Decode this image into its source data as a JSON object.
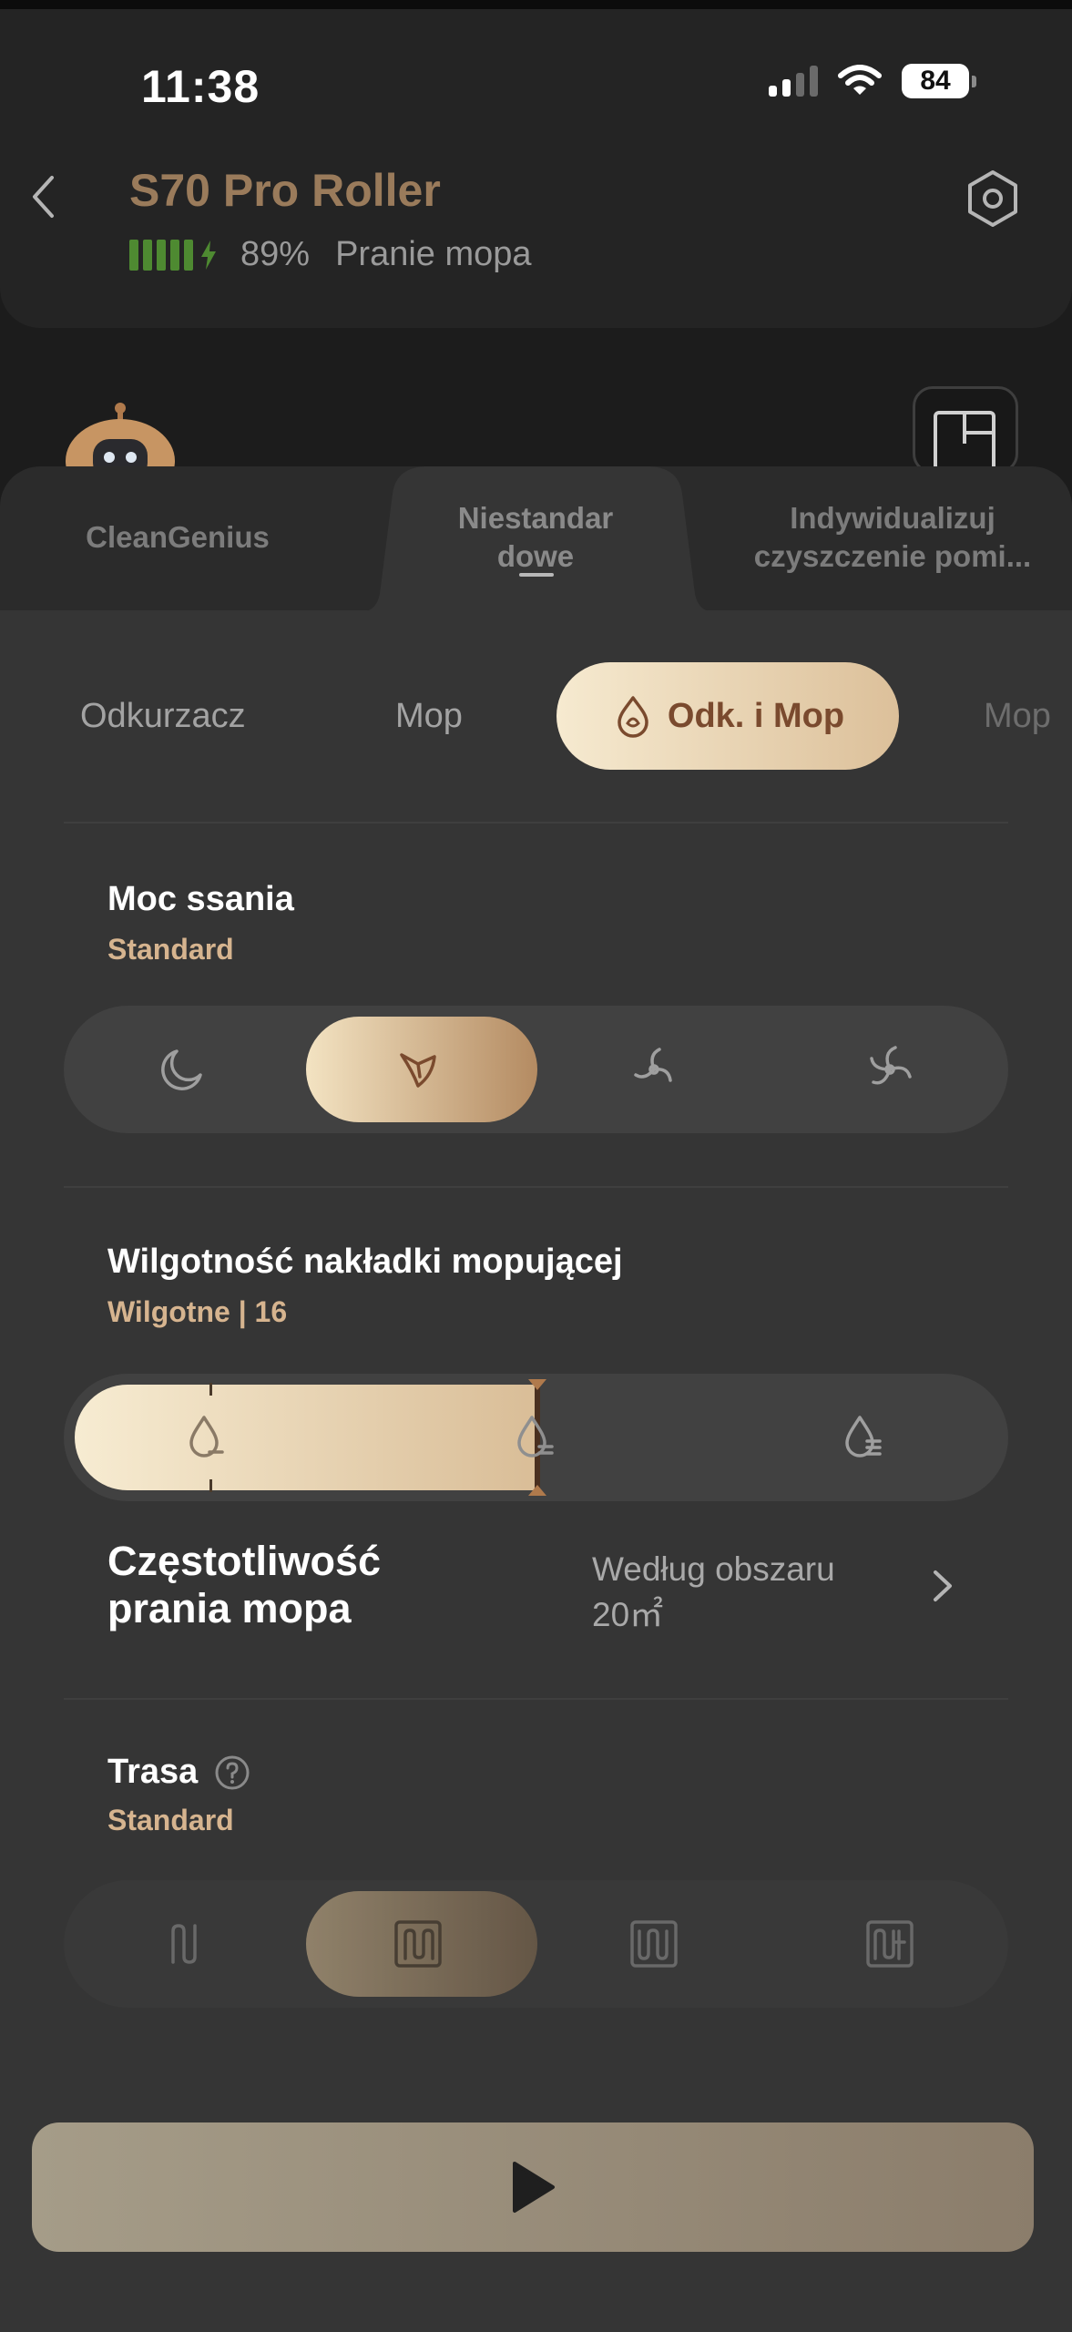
{
  "status_bar": {
    "time": "11:38",
    "battery_level": "84"
  },
  "header": {
    "title": "S70 Pro Roller",
    "battery_percent": "89%",
    "status": "Pranie mopa",
    "icons": {
      "back": "chevron-left-icon",
      "settings": "hex-settings-icon"
    }
  },
  "tabs": [
    {
      "label": "CleanGenius",
      "active": false
    },
    {
      "label": "Niestandar dowe",
      "line1": "Niestandar",
      "line2": "dowe",
      "active": true
    },
    {
      "label": "Indywidualizuj czyszczenie pomi...",
      "line1": "Indywidualizuj",
      "line2": "czyszczenie pomi...",
      "active": false
    }
  ],
  "modes": [
    {
      "label": "Odkurzacz",
      "selected": false
    },
    {
      "label": "Mop",
      "selected": false
    },
    {
      "label": "Odk. i Mop",
      "selected": true
    },
    {
      "label": "Mop",
      "selected": false
    }
  ],
  "suction": {
    "title": "Moc ssania",
    "value": "Standard",
    "options": [
      "quiet-moon-icon",
      "standard-fan-icon",
      "turbo-fan-icon",
      "max-fan-icon"
    ],
    "selected_index": 1
  },
  "mop_humidity": {
    "title": "Wilgotność nakładki mopującej",
    "value": "Wilgotne | 16",
    "level_fraction": 0.5,
    "icons": [
      "drop-low-icon",
      "drop-mid-icon",
      "drop-high-icon"
    ]
  },
  "mop_wash_frequency": {
    "title_line1": "Częstotliwość",
    "title_line2": "prania mopa",
    "value_line1": "Według obszaru",
    "value_line2": "20㎡"
  },
  "route": {
    "title": "Trasa",
    "value": "Standard",
    "options": [
      "route-quick-icon",
      "route-standard-icon",
      "route-intensive-icon",
      "route-deep-icon"
    ],
    "selected_index": 1
  },
  "start_button": {
    "icon": "play-icon"
  },
  "colors": {
    "accent_gold": "#d6b48f",
    "title_brown": "#9a7b5b",
    "battery_green": "#4e8a31"
  }
}
